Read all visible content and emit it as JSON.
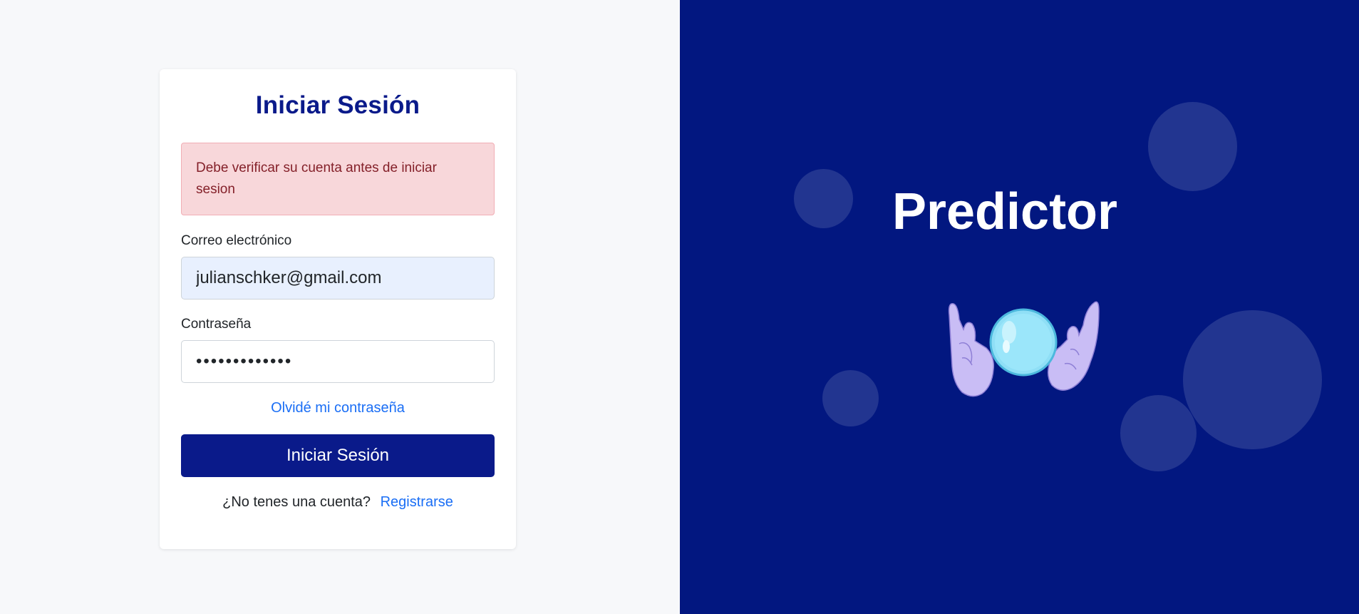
{
  "login": {
    "title": "Iniciar Sesión",
    "alert_message": "Debe verificar su cuenta antes de iniciar sesion",
    "email": {
      "label": "Correo electrónico",
      "value": "julianschker@gmail.com"
    },
    "password": {
      "label": "Contraseña",
      "value": "•••••••••••••"
    },
    "forgot_password": "Olvidé mi contraseña",
    "submit_label": "Iniciar Sesión",
    "register_prompt": "¿No tenes una cuenta?",
    "register_link": "Registrarse"
  },
  "brand": {
    "name": "Predictor",
    "illustration": "crystal-ball-hands-icon"
  },
  "colors": {
    "primary": "#0a1a8a",
    "brand_background": "#021780",
    "alert_background": "#f8d7da",
    "alert_text": "#842029",
    "link": "#1a6ef5"
  }
}
